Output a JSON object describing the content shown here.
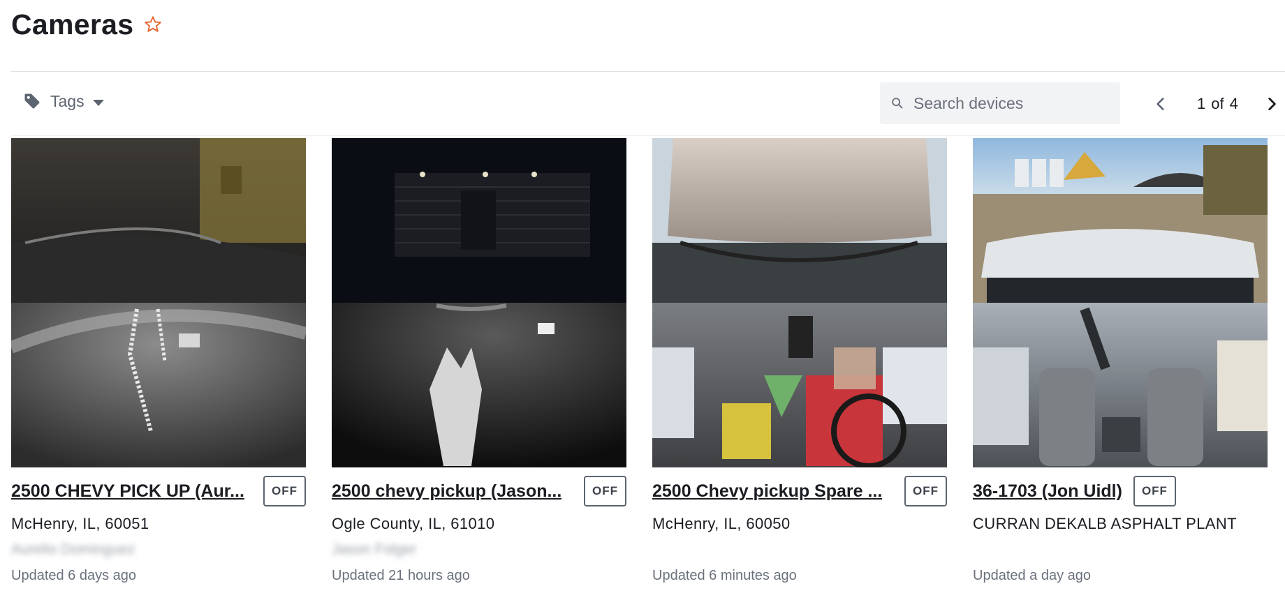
{
  "page": {
    "title": "Cameras"
  },
  "toolbar": {
    "tags_label": "Tags",
    "search_placeholder": "Search devices",
    "pagination": {
      "current": "1",
      "of_label": "of",
      "total": "4"
    }
  },
  "cameras": [
    {
      "name": "2500 CHEVY PICK UP (Aur...",
      "status": "OFF",
      "location": "McHenry, IL, 60051",
      "driver": "Aurelio Dominguez",
      "updated": "Updated 6 days ago"
    },
    {
      "name": "2500 chevy pickup (Jason...",
      "status": "OFF",
      "location": "Ogle County, IL, 61010",
      "driver": "Jason Folger",
      "updated": "Updated 21 hours ago"
    },
    {
      "name": "2500 Chevy pickup Spare ...",
      "status": "OFF",
      "location": "McHenry, IL, 60050",
      "driver": "",
      "updated": "Updated 6 minutes ago"
    },
    {
      "name": "36-1703 (Jon Uidl)",
      "status": "OFF",
      "location": "CURRAN DEKALB ASPHALT PLANT",
      "driver": "",
      "updated": "Updated a day ago"
    }
  ],
  "colors": {
    "accent_star": "#e8632b",
    "text_primary": "#1b1d22",
    "text_muted": "#6a717c"
  },
  "icons": [
    "star-outline-icon",
    "tag-icon",
    "caret-down-icon",
    "search-icon",
    "chevron-left-icon",
    "chevron-right-icon"
  ]
}
